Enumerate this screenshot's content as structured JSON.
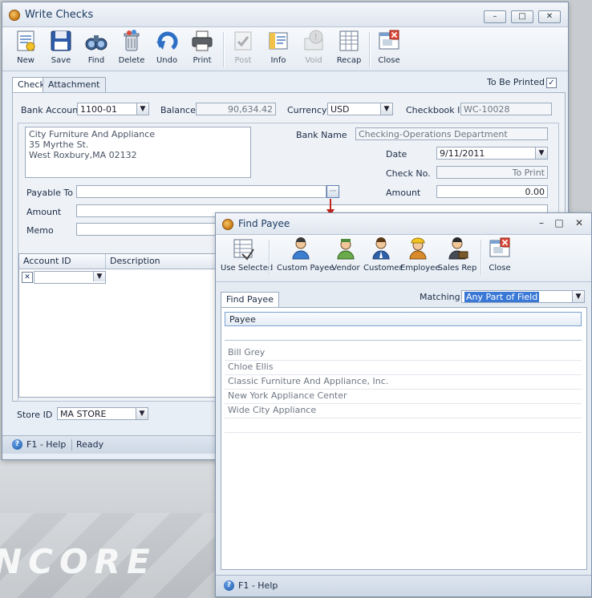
{
  "main_window": {
    "title": "Write Checks",
    "controls": {
      "minimize": "–",
      "maximize": "□",
      "close": "✕"
    },
    "toolbar": [
      {
        "id": "new",
        "label": "New",
        "icon": "new-document-icon",
        "enabled": true
      },
      {
        "id": "save",
        "label": "Save",
        "icon": "floppy-disk-icon",
        "enabled": true
      },
      {
        "id": "find",
        "label": "Find",
        "icon": "binoculars-icon",
        "enabled": true
      },
      {
        "id": "delete",
        "label": "Delete",
        "icon": "trash-can-icon",
        "enabled": true
      },
      {
        "id": "undo",
        "label": "Undo",
        "icon": "undo-arrow-icon",
        "enabled": true
      },
      {
        "id": "print",
        "label": "Print",
        "icon": "printer-icon",
        "enabled": true
      },
      {
        "id": "post",
        "label": "Post",
        "icon": "post-icon",
        "enabled": false
      },
      {
        "id": "info",
        "label": "Info",
        "icon": "info-icon",
        "enabled": true
      },
      {
        "id": "void",
        "label": "Void",
        "icon": "void-icon",
        "enabled": false
      },
      {
        "id": "recap",
        "label": "Recap",
        "icon": "recap-grid-icon",
        "enabled": true
      },
      {
        "id": "close",
        "label": "Close",
        "icon": "close-window-icon",
        "enabled": true
      }
    ],
    "tabs": [
      {
        "label": "Check",
        "active": true
      },
      {
        "label": "Attachment",
        "active": false
      }
    ],
    "to_be_printed": {
      "label": "To Be Printed",
      "checked": true
    },
    "form": {
      "bank_account_label": "Bank Account",
      "bank_account_value": "1100-01",
      "balance_label": "Balance",
      "balance_value": "90,634.42",
      "currency_label": "Currency",
      "currency_value": "USD",
      "checkbook_id_label": "Checkbook ID",
      "checkbook_id_value": "WC-10028",
      "address_lines": [
        "City Furniture And Appliance",
        "35 Myrthe St.",
        "West Roxbury,MA 02132"
      ],
      "bank_name_label": "Bank Name",
      "bank_name_value": "Checking-Operations Department",
      "date_label": "Date",
      "date_value": "9/11/2011",
      "check_no_label": "Check No.",
      "check_no_value": "To Print",
      "payable_to_label": "Payable To",
      "payable_to_value": "",
      "ellipsis": "···",
      "amount_label": "Amount",
      "amount_value": "",
      "amount_right_label": "Amount",
      "amount_right_value": "0.00",
      "memo_label": "Memo",
      "memo_value": ""
    },
    "grid": {
      "columns": [
        "Account ID",
        "Description"
      ],
      "row_marker": "✕"
    },
    "store": {
      "label": "Store ID",
      "value": "MA STORE"
    },
    "status": {
      "help": "F1 - Help",
      "state": "Ready"
    }
  },
  "find_window": {
    "title": "Find Payee",
    "controls": {
      "minimize": "–",
      "maximize": "□",
      "close": "✕"
    },
    "toolbar": [
      {
        "id": "use-selected",
        "label": "Use Selected",
        "icon": "use-selected-icon"
      },
      {
        "id": "custom-payee",
        "label": "Custom Payee",
        "icon": "custom-payee-icon"
      },
      {
        "id": "vendor",
        "label": "Vendor",
        "icon": "vendor-icon"
      },
      {
        "id": "customer",
        "label": "Customer",
        "icon": "customer-icon"
      },
      {
        "id": "employee",
        "label": "Employee",
        "icon": "employee-icon"
      },
      {
        "id": "sales-rep",
        "label": "Sales Rep",
        "icon": "sales-rep-icon"
      },
      {
        "id": "close",
        "label": "Close",
        "icon": "close-window-icon"
      }
    ],
    "tab": "Find Payee",
    "matching_label": "Matching",
    "matching_value": "Any Part of Field",
    "column": "Payee",
    "payees": [
      "Bill Grey",
      "Chloe Ellis",
      "Classic Furniture And Appliance, Inc.",
      "New York Appliance Center",
      "Wide City Appliance"
    ],
    "status": {
      "help": "F1 - Help"
    }
  },
  "colors": {
    "accent": "#1b56a8",
    "selection": "#3a78d6",
    "arrow": "#c0281e"
  }
}
